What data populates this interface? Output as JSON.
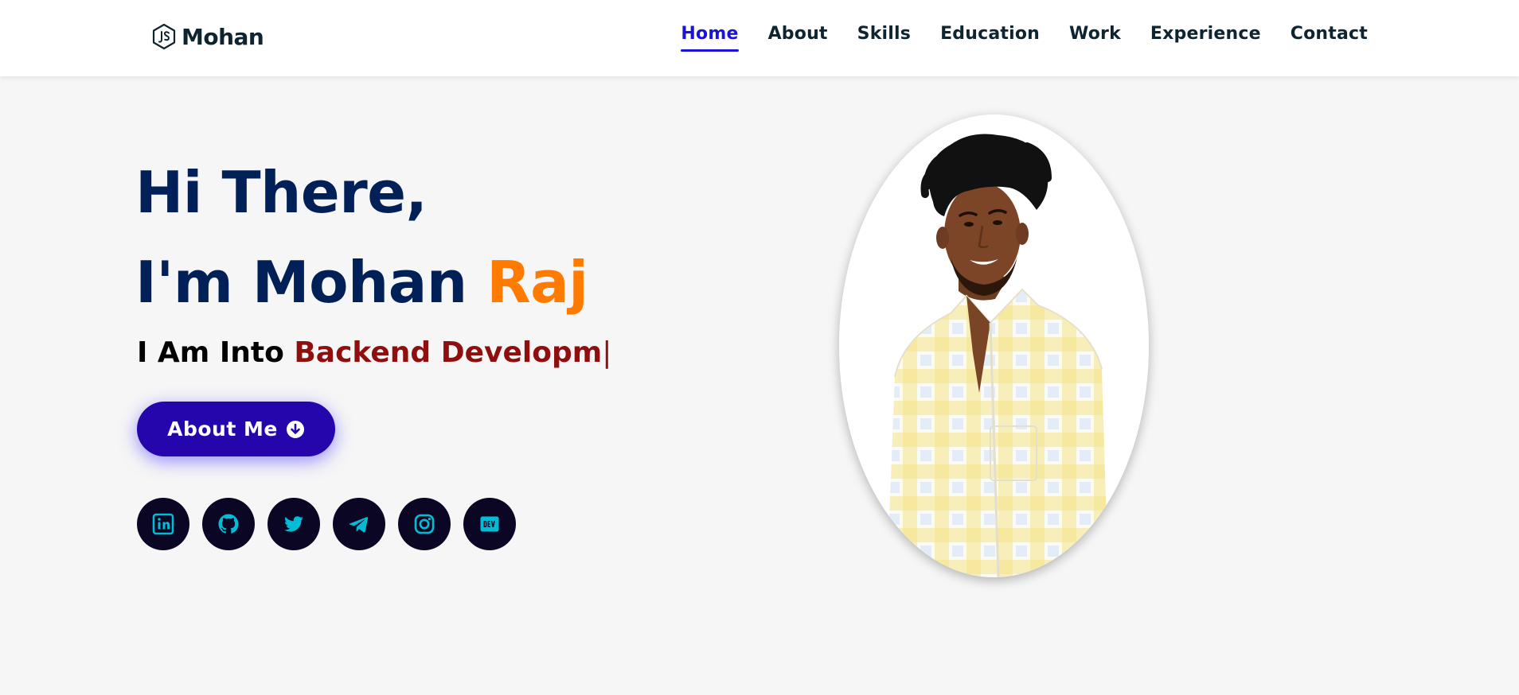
{
  "brand": {
    "name": "Mohan",
    "icon": "nodejs-hexagon-icon"
  },
  "nav": {
    "items": [
      {
        "label": "Home",
        "active": true
      },
      {
        "label": "About",
        "active": false
      },
      {
        "label": "Skills",
        "active": false
      },
      {
        "label": "Education",
        "active": false
      },
      {
        "label": "Work",
        "active": false
      },
      {
        "label": "Experience",
        "active": false
      },
      {
        "label": "Contact",
        "active": false
      }
    ]
  },
  "hero": {
    "greeting": "Hi There,",
    "intro": "I'm Mohan ",
    "name_accent": "Raj",
    "tagline_prefix": "I Am Into ",
    "tagline_typed": "Backend Developm",
    "cursor": "|",
    "cta_label": "About Me",
    "cta_icon": "arrow-down-circle-icon"
  },
  "socials": [
    {
      "name": "LinkedIn",
      "icon": "linkedin-icon"
    },
    {
      "name": "GitHub",
      "icon": "github-icon"
    },
    {
      "name": "Twitter",
      "icon": "twitter-icon"
    },
    {
      "name": "Telegram",
      "icon": "telegram-icon"
    },
    {
      "name": "Instagram",
      "icon": "instagram-icon"
    },
    {
      "name": "DEV",
      "icon": "dev-icon"
    }
  ],
  "colors": {
    "navy": "#002057",
    "accent_orange": "#ff7b00",
    "typed_red": "#8f0f0f",
    "button_purple": "#2506ad",
    "active_nav": "#1a14d8",
    "social_bg": "#0b0624",
    "social_icon": "#00bcd4",
    "page_bg": "#f6f6f6"
  }
}
